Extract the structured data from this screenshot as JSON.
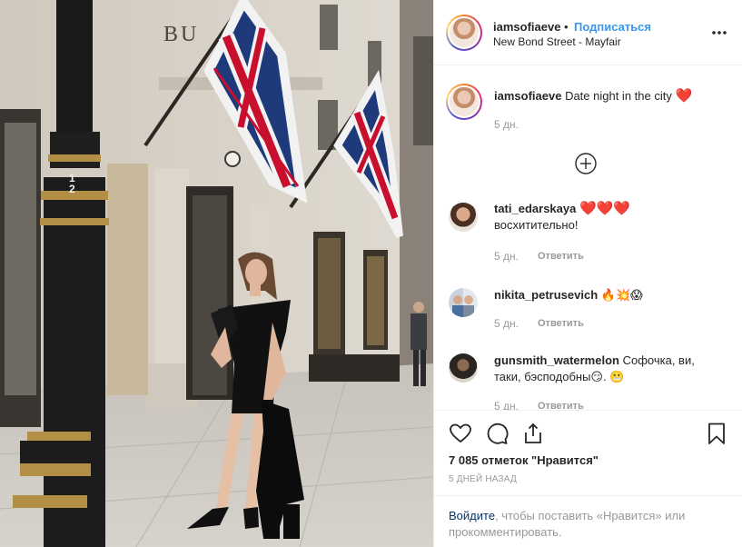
{
  "post": {
    "username": "iamsofiaeve",
    "separator": "•",
    "follow_label": "Подписаться",
    "location": "New Bond Street - Mayfair"
  },
  "caption": {
    "username": "iamsofiaeve",
    "text": "Date night in the city",
    "emoji": "❤️",
    "time": "5 дн."
  },
  "comments": [
    {
      "username": "tati_edarskaya",
      "text_line1": "❤️❤️❤️",
      "text_line2": "восхитительно!",
      "time": "5 дн.",
      "reply": "Ответить"
    },
    {
      "username": "nikita_petrusevich",
      "text_line1": "🔥💥😱",
      "time": "5 дн.",
      "reply": "Ответить"
    },
    {
      "username": "gunsmith_watermelon",
      "text_line1": "Софочка, ви,",
      "text_line2": "таки, бэсподобны😏. 😬",
      "time": "5 дн.",
      "reply": "Ответить"
    }
  ],
  "likes_text": "7 085 отметок \"Нравится\"",
  "date_text": "5 ДНЕЙ НАЗАД",
  "login": {
    "link": "Войдите",
    "rest": ", чтобы поставить «Нравится» или прокомментировать."
  },
  "photo": {
    "sign_text": "BU",
    "lamp_numbers": [
      "1",
      "2"
    ]
  },
  "colors": {
    "link_blue": "#3897f0",
    "heart_red": "#ed4956",
    "text": "#262626",
    "muted": "#999999"
  }
}
